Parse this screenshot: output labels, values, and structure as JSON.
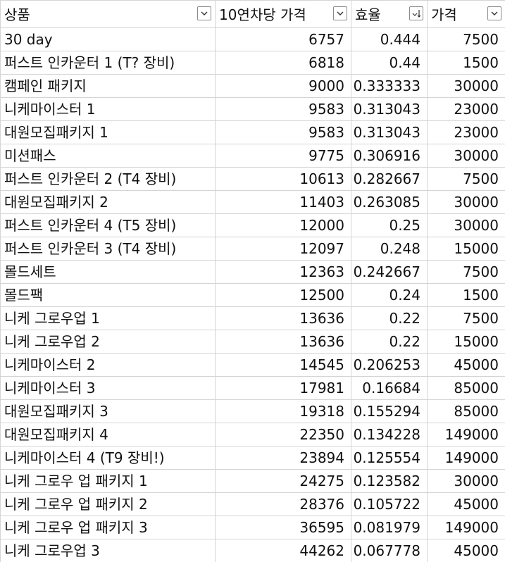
{
  "headers": {
    "product": "상품",
    "cost_per_10": "10연차당 가격",
    "efficiency": "효율",
    "price": "가격"
  },
  "filter_icons": {
    "product": "filter-dropdown-icon",
    "cost_per_10": "filter-dropdown-icon",
    "efficiency": "sort-descending-filter-icon",
    "price": "filter-dropdown-icon"
  },
  "rows": [
    {
      "product": "30 day",
      "cost": "6757",
      "eff": "0.444",
      "price": "7500"
    },
    {
      "product": "퍼스트 인카운터 1 (T? 장비)",
      "cost": "6818",
      "eff": "0.44",
      "price": "1500"
    },
    {
      "product": "캠페인 패키지",
      "cost": "9000",
      "eff": "0.333333",
      "price": "30000"
    },
    {
      "product": "니케마이스터 1",
      "cost": "9583",
      "eff": "0.313043",
      "price": "23000"
    },
    {
      "product": "대원모집패키지 1",
      "cost": "9583",
      "eff": "0.313043",
      "price": "23000"
    },
    {
      "product": "미션패스",
      "cost": "9775",
      "eff": "0.306916",
      "price": "30000"
    },
    {
      "product": "퍼스트 인카운터 2 (T4 장비)",
      "cost": "10613",
      "eff": "0.282667",
      "price": "7500"
    },
    {
      "product": "대원모집패키지 2",
      "cost": "11403",
      "eff": "0.263085",
      "price": "30000"
    },
    {
      "product": "퍼스트 인카운터 4 (T5 장비)",
      "cost": "12000",
      "eff": "0.25",
      "price": "30000"
    },
    {
      "product": "퍼스트 인카운터 3 (T4 장비)",
      "cost": "12097",
      "eff": "0.248",
      "price": "15000"
    },
    {
      "product": "몰드세트",
      "cost": "12363",
      "eff": "0.242667",
      "price": "7500"
    },
    {
      "product": "몰드팩",
      "cost": "12500",
      "eff": "0.24",
      "price": "1500"
    },
    {
      "product": "니케 그로우업 1",
      "cost": "13636",
      "eff": "0.22",
      "price": "7500"
    },
    {
      "product": "니케 그로우업 2",
      "cost": "13636",
      "eff": "0.22",
      "price": "15000"
    },
    {
      "product": "니케마이스터 2",
      "cost": "14545",
      "eff": "0.206253",
      "price": "45000"
    },
    {
      "product": "니케마이스터 3",
      "cost": "17981",
      "eff": "0.16684",
      "price": "85000"
    },
    {
      "product": "대원모집패키지 3",
      "cost": "19318",
      "eff": "0.155294",
      "price": "85000"
    },
    {
      "product": "대원모집패키지 4",
      "cost": "22350",
      "eff": "0.134228",
      "price": "149000"
    },
    {
      "product": "니케마이스터 4 (T9 장비!)",
      "cost": "23894",
      "eff": "0.125554",
      "price": "149000"
    },
    {
      "product": "니케 그로우 업 패키지 1",
      "cost": "24275",
      "eff": "0.123582",
      "price": "30000"
    },
    {
      "product": "니케 그로우 업 패키지 2",
      "cost": "28376",
      "eff": "0.105722",
      "price": "45000"
    },
    {
      "product": "니케 그로우 업 패키지 3",
      "cost": "36595",
      "eff": "0.081979",
      "price": "149000"
    },
    {
      "product": "니케 그로우업 3",
      "cost": "44262",
      "eff": "0.067778",
      "price": "45000"
    }
  ]
}
